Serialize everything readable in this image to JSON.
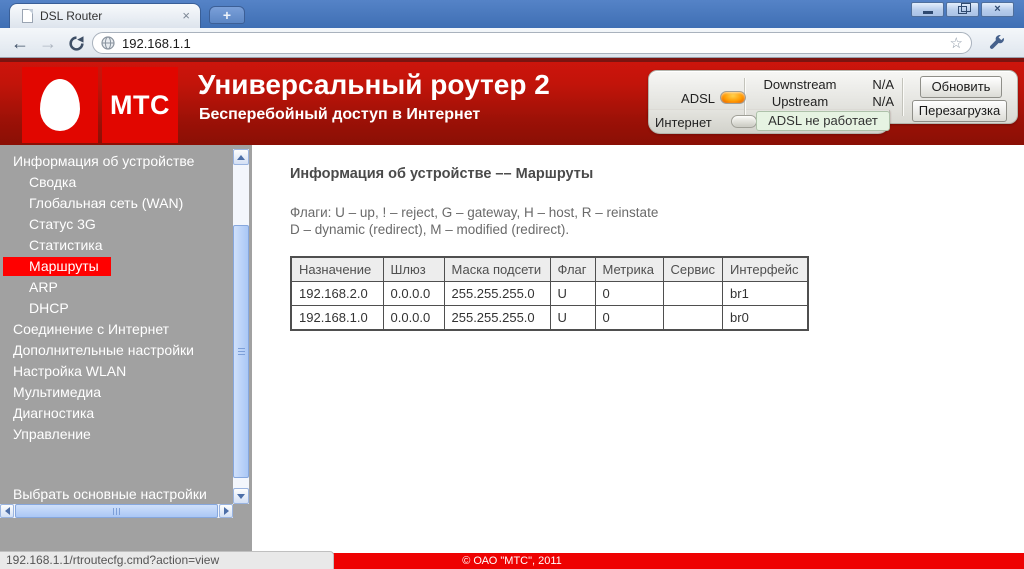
{
  "browser": {
    "tab_title": "DSL Router",
    "url": "192.168.1.1",
    "status_url": "192.168.1.1/rtroutecfg.cmd?action=view"
  },
  "icons": {
    "back": "←",
    "forward": "→",
    "star": "☆",
    "tab_close": "×",
    "window_close": "×",
    "new_tab": "+"
  },
  "header": {
    "logo_text": "МТС",
    "title": "Универсальный роутер 2",
    "subtitle": "Бесперебойный доступ в Интернет"
  },
  "status_panel": {
    "adsl_label": "ADSL",
    "downstream_label": "Downstream",
    "downstream_value": "N/A",
    "upstream_label": "Upstream",
    "upstream_value": "N/A",
    "refresh_button": "Обновить",
    "reboot_button": "Перезагрузка",
    "internet_label": "Интернет",
    "adsl_status_message": "ADSL не работает"
  },
  "sidebar": {
    "items": [
      {
        "label": "Информация об устройстве",
        "level": 0,
        "selected": false
      },
      {
        "label": "Сводка",
        "level": 1,
        "selected": false
      },
      {
        "label": "Глобальная сеть (WAN)",
        "level": 1,
        "selected": false
      },
      {
        "label": "Статус 3G",
        "level": 1,
        "selected": false
      },
      {
        "label": "Статистика",
        "level": 1,
        "selected": false
      },
      {
        "label": "Маршруты",
        "level": 1,
        "selected": true
      },
      {
        "label": "ARP",
        "level": 1,
        "selected": false
      },
      {
        "label": "DHCP",
        "level": 1,
        "selected": false
      },
      {
        "label": "Соединение с Интернет",
        "level": 0,
        "selected": false
      },
      {
        "label": "Дополнительные настройки",
        "level": 0,
        "selected": false
      },
      {
        "label": "Настройка WLAN",
        "level": 0,
        "selected": false
      },
      {
        "label": "Мультимедиа",
        "level": 0,
        "selected": false
      },
      {
        "label": "Диагностика",
        "level": 0,
        "selected": false
      },
      {
        "label": "Управление",
        "level": 0,
        "selected": false
      }
    ],
    "bottom_item": "Выбрать основные настройки"
  },
  "main": {
    "heading": "Информация об устройстве –– Маршруты",
    "flags_line1": "Флаги: U – up, ! – reject, G – gateway, H – host, R – reinstate",
    "flags_line2": "D – dynamic (redirect), M – modified (redirect).",
    "table": {
      "headers": [
        "Назначение",
        "Шлюз",
        "Маска подсети",
        "Флаг",
        "Метрика",
        "Сервис",
        "Интерфейс"
      ],
      "rows": [
        [
          "192.168.2.0",
          "0.0.0.0",
          "255.255.255.0",
          "U",
          "0",
          "",
          "br1"
        ],
        [
          "192.168.1.0",
          "0.0.0.0",
          "255.255.255.0",
          "U",
          "0",
          "",
          "br0"
        ]
      ]
    }
  },
  "footer": {
    "copyright": "© ОАО \"МТС\", 2011"
  },
  "colors": {
    "brand_red": "#e10600",
    "header_red_bright": "#cf150c",
    "header_red_dark": "#8a0f05",
    "selected_item_red": "#ff0000",
    "footer_red": "#ee0202",
    "sidebar_gray": "#a1a1a1",
    "adsl_led_orange": "#ff9900",
    "chrome_blue": "#4a79c0"
  }
}
